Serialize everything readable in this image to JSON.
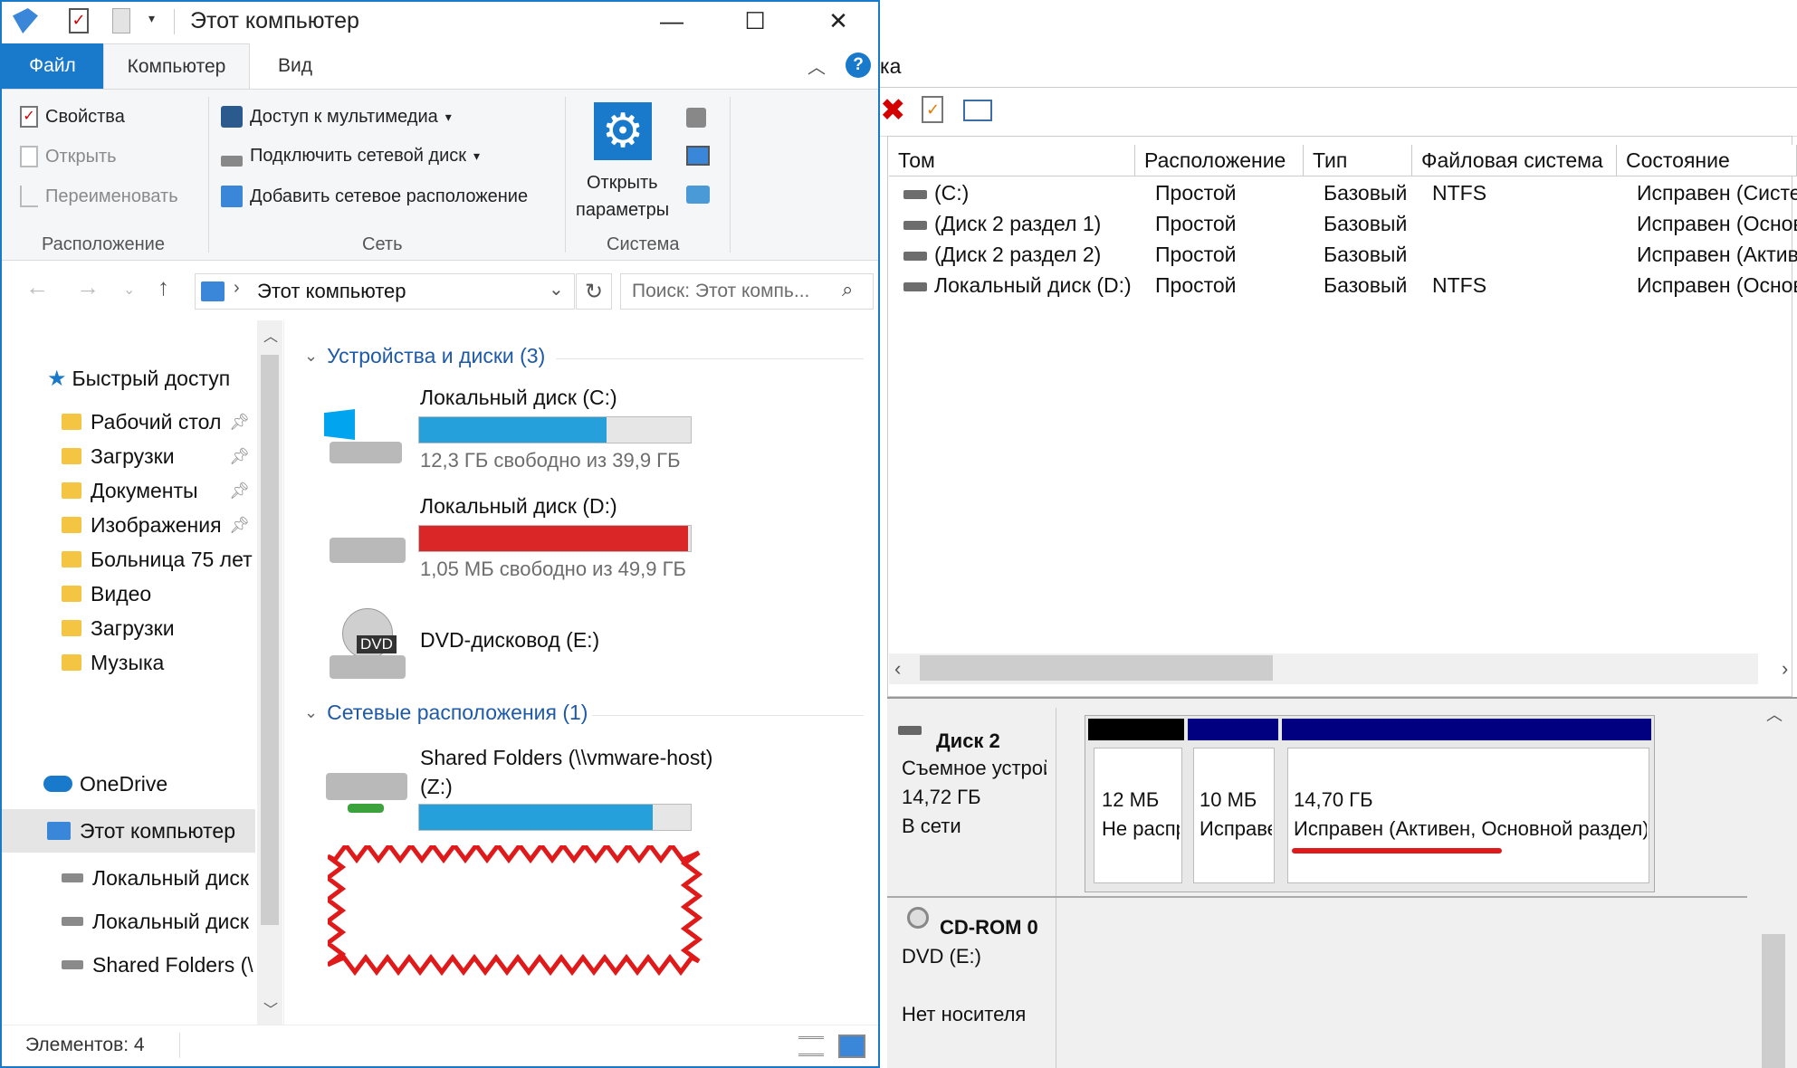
{
  "explorer": {
    "title": "Этот компьютер",
    "tabs": [
      "Файл",
      "Компьютер",
      "Вид"
    ],
    "ribbon": {
      "location": {
        "properties": "Свойства",
        "open": "Открыть",
        "rename": "Переименовать",
        "group": "Расположение"
      },
      "network": {
        "media": "Доступ к мультимедиа",
        "map_drive": "Подключить сетевой диск",
        "add_location": "Добавить сетевое расположение",
        "group": "Сеть"
      },
      "system": {
        "open_settings_1": "Открыть",
        "open_settings_2": "параметры",
        "group": "Система"
      }
    },
    "address": "Этот компьютер",
    "search_placeholder": "Поиск: Этот компь...",
    "nav": {
      "quick_access": "Быстрый доступ",
      "items": [
        {
          "label": "Рабочий стол",
          "pinned": true
        },
        {
          "label": "Загрузки",
          "pinned": true
        },
        {
          "label": "Документы",
          "pinned": true
        },
        {
          "label": "Изображения",
          "pinned": true
        },
        {
          "label": "Больница 75 лет",
          "pinned": false
        },
        {
          "label": "Видео",
          "pinned": false
        },
        {
          "label": "Загрузки",
          "pinned": false
        },
        {
          "label": "Музыка",
          "pinned": false
        }
      ],
      "onedrive": "OneDrive",
      "this_pc": "Этот компьютер",
      "pc_items": [
        "Локальный диск",
        "Локальный диск",
        "Shared Folders (\\"
      ]
    },
    "sections": {
      "devices": "Устройства и диски (3)",
      "network": "Сетевые расположения (1)"
    },
    "drives": [
      {
        "name": "Локальный диск (C:)",
        "free": "12,3 ГБ свободно из 39,9 ГБ",
        "used_fraction": 0.69,
        "color": "#26a0da"
      },
      {
        "name": "Локальный диск (D:)",
        "free": "1,05 МБ свободно из 49,9 ГБ",
        "used_fraction": 0.99,
        "color": "#da2626"
      }
    ],
    "dvd": {
      "name": "DVD-дисковод (E:)",
      "badge": "DVD"
    },
    "network_drive": {
      "name_1": "Shared Folders (\\\\vmware-host)",
      "name_2": "(Z:)",
      "used_fraction": 0.86,
      "color": "#26a0da"
    },
    "status": "Элементов: 4"
  },
  "diskmgmt": {
    "title_fragment": "ка",
    "columns": [
      "Том",
      "Расположение",
      "Тип",
      "Файловая система",
      "Состояние"
    ],
    "rows": [
      [
        "(C:)",
        "Простой",
        "Базовый",
        "NTFS",
        "Исправен (Системный"
      ],
      [
        "(Диск 2 раздел 1)",
        "Простой",
        "Базовый",
        "",
        "Исправен (Основной"
      ],
      [
        "(Диск 2 раздел 2)",
        "Простой",
        "Базовый",
        "",
        "Исправен (Активен"
      ],
      [
        "Локальный диск (D:)",
        "Простой",
        "Базовый",
        "NTFS",
        "Исправен (Основной"
      ]
    ],
    "disk2": {
      "name": "Диск 2",
      "type": "Съемное устройство",
      "size": "14,72 ГБ",
      "status": "В сети"
    },
    "partitions": [
      {
        "size": "12 МБ",
        "status": "Не распределена"
      },
      {
        "size": "10 МБ",
        "status": "Исправен"
      },
      {
        "size": "14,70 ГБ",
        "status": "Исправен (Активен, Основной раздел)"
      }
    ],
    "cdrom": {
      "name": "CD-ROM 0",
      "drive": "DVD (E:)",
      "status": "Нет носителя"
    }
  }
}
